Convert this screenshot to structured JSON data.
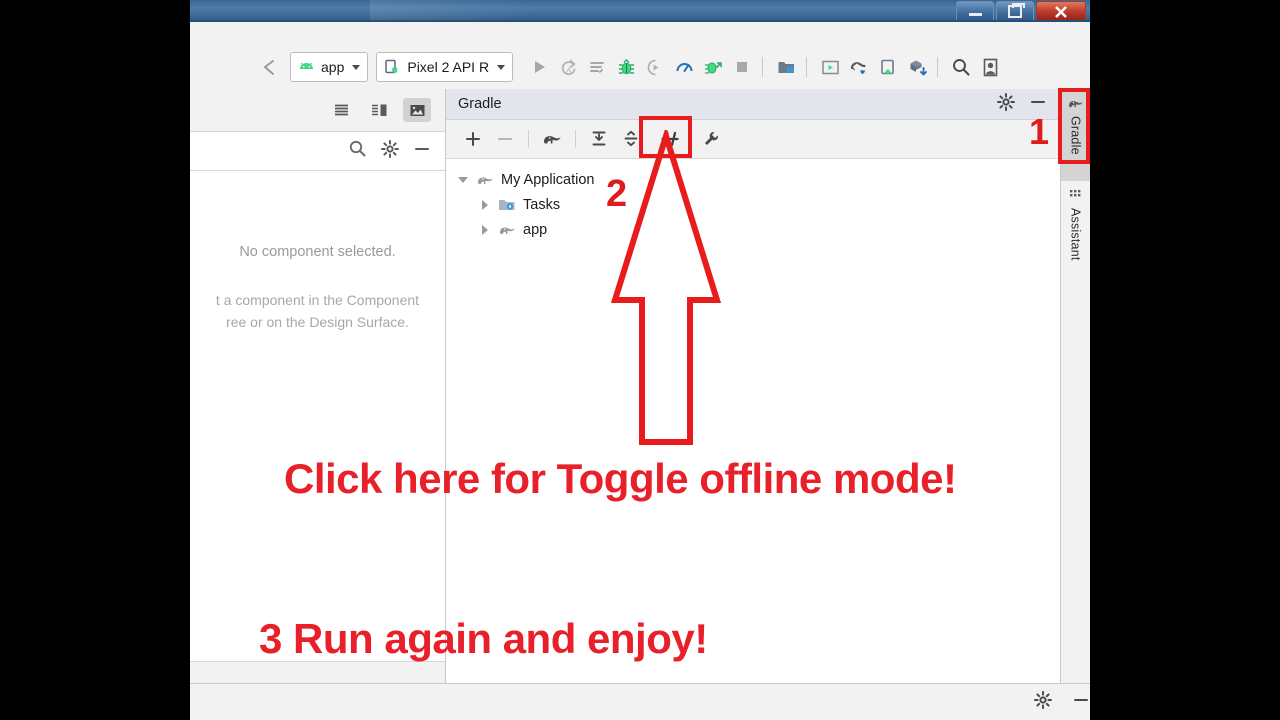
{
  "window": {
    "title": "",
    "controls": [
      {
        "name": "minimize",
        "glyph": "—"
      },
      {
        "name": "restore",
        "glyph": "❐"
      },
      {
        "name": "close",
        "glyph": "✕"
      }
    ]
  },
  "toolbar": {
    "back_icon": "navigate-back-icon",
    "module_selector": {
      "label": "app",
      "icon": "android-icon"
    },
    "device_selector": {
      "label": "Pixel 2 API R",
      "icon": "device-phone-icon"
    },
    "actions": [
      {
        "name": "run-button",
        "icon": "play-icon",
        "enabled": false
      },
      {
        "name": "apply-changes-button",
        "icon": "apply-changes-icon",
        "enabled": false
      },
      {
        "name": "apply-code-changes-button",
        "icon": "apply-code-changes-icon",
        "enabled": false
      },
      {
        "name": "debug-button",
        "icon": "debug-bug-icon",
        "enabled": true
      },
      {
        "name": "attach-debugger-button",
        "icon": "attach-debugger-icon",
        "enabled": false
      },
      {
        "name": "profiler-button",
        "icon": "profiler-icon",
        "enabled": true
      },
      {
        "name": "run-coverage-button",
        "icon": "run-with-coverage-icon",
        "enabled": true
      },
      {
        "name": "stop-button",
        "icon": "stop-square-icon",
        "enabled": false
      },
      {
        "name": "sdk-manager-button",
        "icon": "sdk-manager-icon",
        "enabled": true
      },
      {
        "name": "avd-manager-button",
        "icon": "avd-manager-icon",
        "enabled": true
      },
      {
        "name": "sync-gradle-button",
        "icon": "gradle-sync-icon",
        "enabled": true
      },
      {
        "name": "layout-inspector-button",
        "icon": "layout-inspector-icon",
        "enabled": true
      },
      {
        "name": "apk-analyzer-button",
        "icon": "apk-download-icon",
        "enabled": true
      },
      {
        "name": "search-everywhere-button",
        "icon": "search-icon",
        "enabled": true
      },
      {
        "name": "account-button",
        "icon": "user-avatar-icon",
        "enabled": true
      }
    ]
  },
  "left_panel": {
    "view_modes": [
      {
        "name": "code-view",
        "icon": "code-lines-icon",
        "selected": false
      },
      {
        "name": "split-view",
        "icon": "split-view-icon",
        "selected": false
      },
      {
        "name": "design-view",
        "icon": "design-image-icon",
        "selected": true
      }
    ],
    "tools": [
      {
        "name": "search-icon"
      },
      {
        "name": "gear-icon"
      },
      {
        "name": "minimize-icon"
      }
    ],
    "empty_title": "No component selected.",
    "empty_hint_line1": "t a component in the Component",
    "empty_hint_line2": "ree or on the Design Surface."
  },
  "gradle_panel": {
    "title": "Gradle",
    "header_icons": [
      {
        "name": "gear-icon"
      },
      {
        "name": "minimize-icon"
      }
    ],
    "toolbar": [
      {
        "name": "add-gradle-project-button",
        "icon": "plus-icon",
        "enabled": true
      },
      {
        "name": "remove-gradle-project-button",
        "icon": "minus-icon",
        "enabled": false
      },
      {
        "name": "execute-gradle-task-button",
        "icon": "gradle-elephant-icon",
        "enabled": true
      },
      {
        "name": "expand-all-button",
        "icon": "expand-all-icon",
        "enabled": true
      },
      {
        "name": "collapse-all-button",
        "icon": "collapse-all-icon",
        "enabled": true
      },
      {
        "name": "toggle-offline-mode-button",
        "icon": "toggle-offline-icon",
        "enabled": true,
        "highlighted": true
      },
      {
        "name": "gradle-settings-button",
        "icon": "wrench-icon",
        "enabled": true
      }
    ],
    "tree": [
      {
        "label": "My Application",
        "icon": "gradle-elephant-icon",
        "expanded": true,
        "depth": 0
      },
      {
        "label": "Tasks",
        "icon": "tasks-folder-icon",
        "expanded": false,
        "depth": 1
      },
      {
        "label": "app",
        "icon": "gradle-elephant-icon",
        "expanded": false,
        "depth": 1
      }
    ]
  },
  "right_sidebar": {
    "tabs": [
      {
        "label": "Gradle",
        "icon": "gradle-elephant-icon",
        "selected": true,
        "highlighted": true
      },
      {
        "label": "Assistant",
        "icon": "assistant-grid-icon",
        "selected": false
      }
    ]
  },
  "status_bar": {
    "icons": [
      {
        "name": "gear-icon"
      },
      {
        "name": "minimize-icon"
      }
    ]
  },
  "annotations": {
    "color": "#e8202a",
    "step1_marker": "1",
    "step2_marker": "2",
    "callout_line1": "Click here for Toggle offline mode!",
    "callout_line2": "3 Run again and enjoy!",
    "arrow": "up-arrow-outline",
    "highlight_boxes": [
      {
        "name": "toggle-offline-highlight"
      },
      {
        "name": "gradle-tab-highlight"
      }
    ]
  }
}
